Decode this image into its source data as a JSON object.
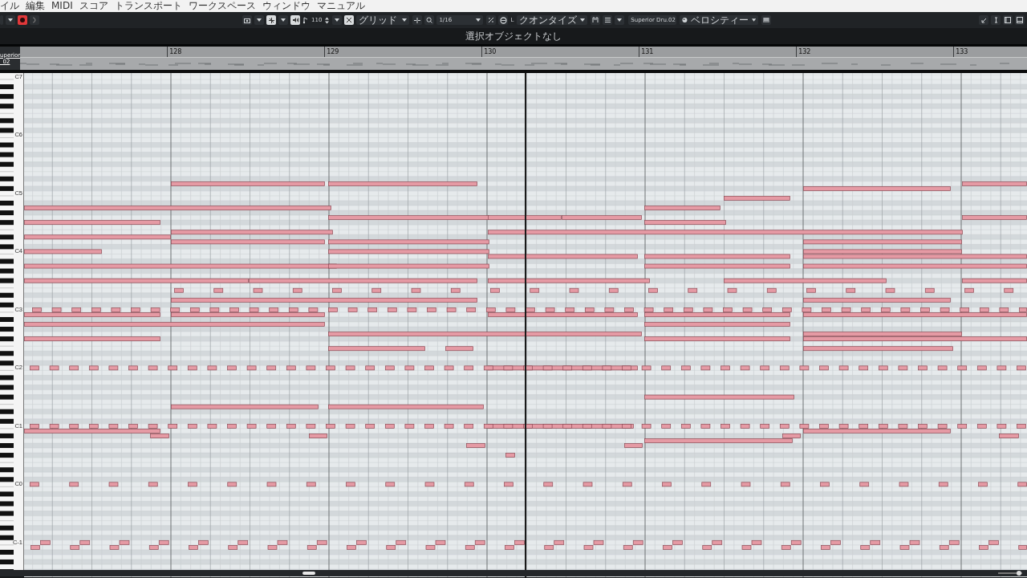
{
  "menu": [
    "イル",
    "編集",
    "MIDI",
    "スコア",
    "トランスポート",
    "ワークスペース",
    "ウィンドウ",
    "マニュアル"
  ],
  "transport": {
    "record": {
      "on": true
    }
  },
  "toolbar": {
    "tempo": "110",
    "snap_type": "グリッド",
    "quantize": "1/16",
    "length_label": "L",
    "length_quantize": "クオンタイズ",
    "instrument": "Superior Dru.02",
    "controller_lane": "ベロシティー"
  },
  "info_line": "選択オブジェクトなし",
  "ruler": {
    "track_label": "uperior _02",
    "bars": [
      "128",
      "129",
      "130",
      "131",
      "132",
      "133"
    ]
  },
  "zoom_slider": {
    "level": 0.85
  },
  "keyboard": {
    "octave_labels": [
      "C7",
      "C6",
      "C5",
      "C4",
      "C3",
      "C2",
      "C1",
      "C0",
      "C-1"
    ]
  }
}
